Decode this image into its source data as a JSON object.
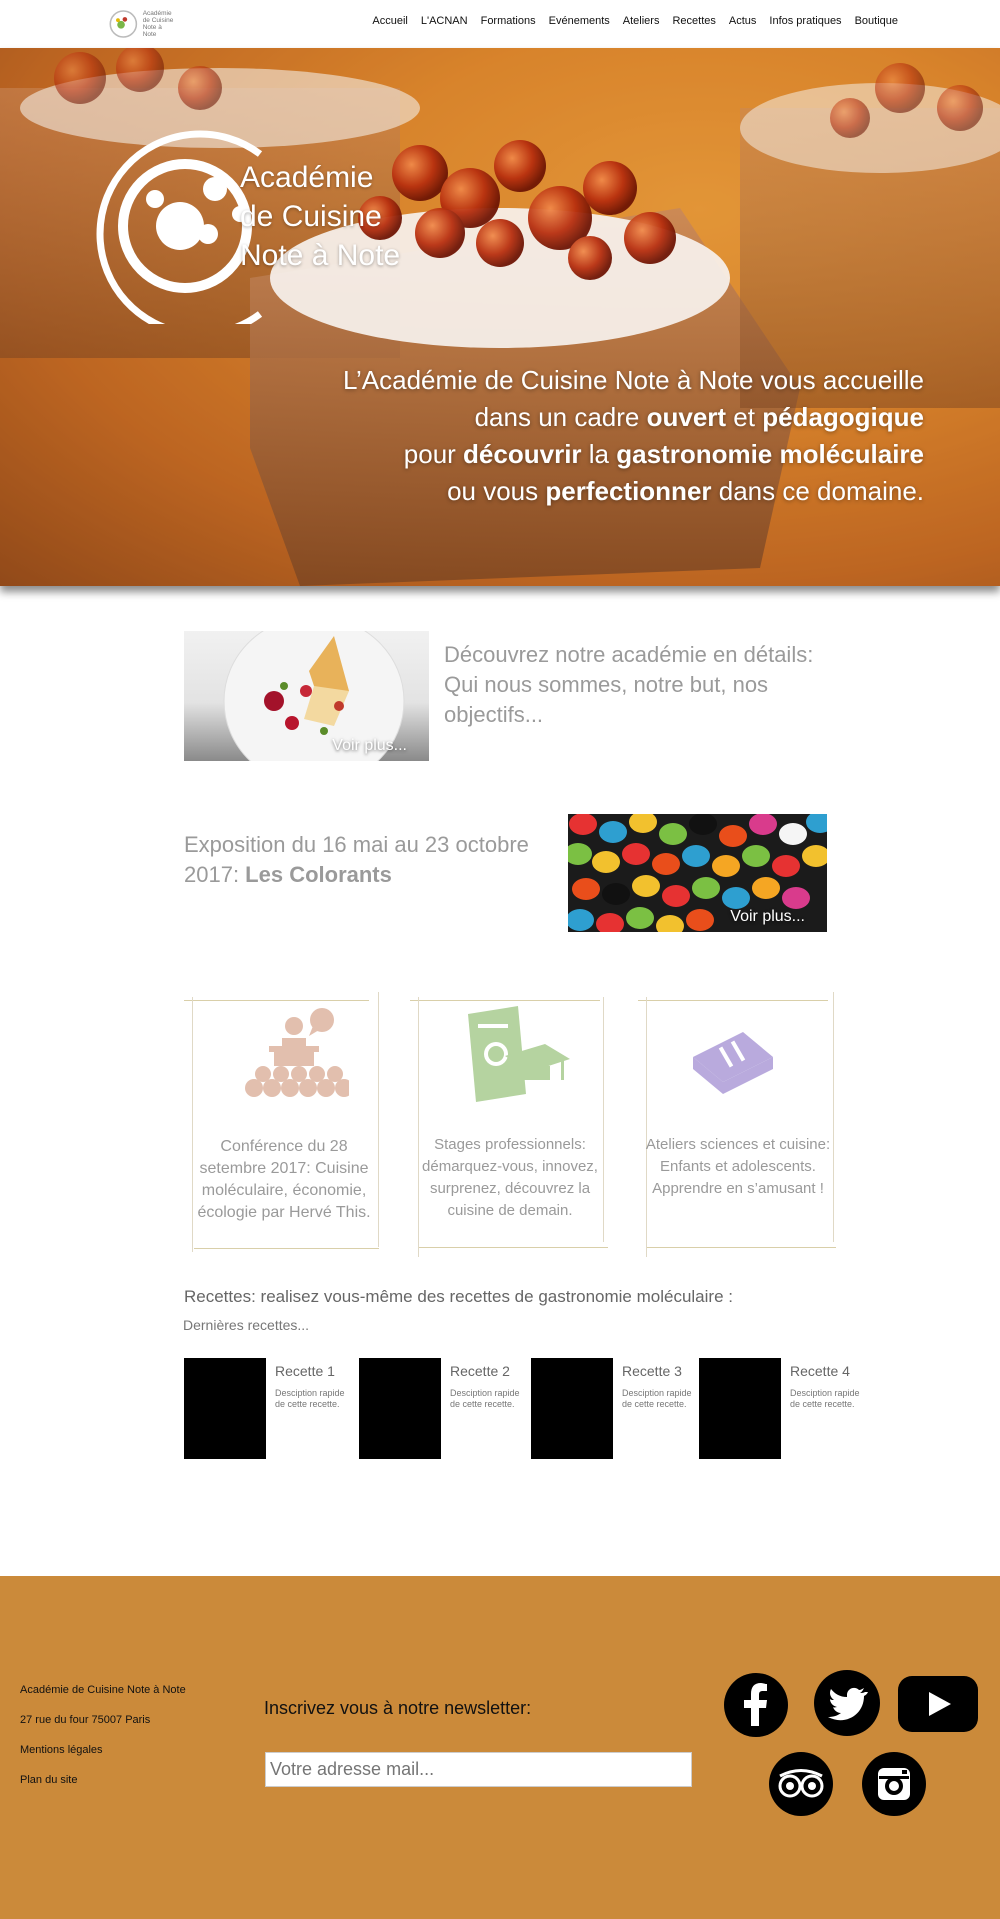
{
  "nav": {
    "logo_text": [
      "Académie",
      "de Cuisine",
      "Note à Note"
    ],
    "items": [
      "Accueil",
      "L'ACNAN",
      "Formations",
      "Evénements",
      "Ateliers",
      "Recettes",
      "Actus",
      "Infos pratiques",
      "Boutique"
    ]
  },
  "hero": {
    "logo_lines": [
      "Académie",
      "de Cuisine",
      "Note à Note"
    ],
    "tagline": {
      "line1": "L’Académie de Cuisine Note à Note vous accueille",
      "line2_pre": "dans un cadre ",
      "line2_b1": "ouvert",
      "line2_mid": " et ",
      "line2_b2": "pédagogique",
      "line3_pre": "pour ",
      "line3_b1": "découvrir",
      "line3_mid": " la ",
      "line3_b2": "gastronomie moléculaire",
      "line4_pre": "ou vous ",
      "line4_b1": "perfectionner",
      "line4_post": " dans ce domaine."
    }
  },
  "features": {
    "academy": {
      "text": "Découvrez  notre académie en détails: Qui nous sommes, notre but, nos objectifs...",
      "more": "Voir plus..."
    },
    "exhibition": {
      "text": "Exposition du 16 mai au 23 octobre 2017: ",
      "bold": "Les Colorants",
      "more": "Voir plus..."
    }
  },
  "cards": [
    {
      "icon": "conference-icon",
      "color": "#e2bfae",
      "text": "Conférence du 28 setembre 2017: Cuisine moléculaire, économie, écologie par Hervé This."
    },
    {
      "icon": "diploma-icon",
      "color": "#b5d3a0",
      "text": "Stages professionnels: démarquez-vous, innovez, surprenez, découvrez la cuisine de demain."
    },
    {
      "icon": "cookbook-icon",
      "color": "#b9aadd",
      "text": "Ateliers sciences et cuisine: Enfants et adolescents. Apprendre en s’amusant !"
    }
  ],
  "recipes": {
    "title": "Recettes: realisez vous-même des recettes de gastronomie moléculaire :",
    "subtitle": "Dernières recettes...",
    "items": [
      {
        "name": "Recette 1",
        "desc": "Desciption rapide de cette recette."
      },
      {
        "name": "Recette 2",
        "desc": "Desciption rapide de cette recette."
      },
      {
        "name": "Recette 3",
        "desc": "Desciption rapide de cette recette."
      },
      {
        "name": "Recette 4",
        "desc": "Desciption rapide de cette recette."
      }
    ]
  },
  "footer": {
    "name": "Académie de Cuisine Note à Note",
    "address": "27 rue du four 75007 Paris",
    "legal": "Mentions légales",
    "sitemap": "Plan du site",
    "newsletter_title": "Inscrivez vous à notre newsletter:",
    "newsletter_placeholder": "Votre adresse mail...",
    "social": [
      "facebook-icon",
      "twitter-icon",
      "youtube-icon",
      "tripadvisor-icon",
      "instagram-icon"
    ],
    "bg_color": "#cb8a3a"
  }
}
